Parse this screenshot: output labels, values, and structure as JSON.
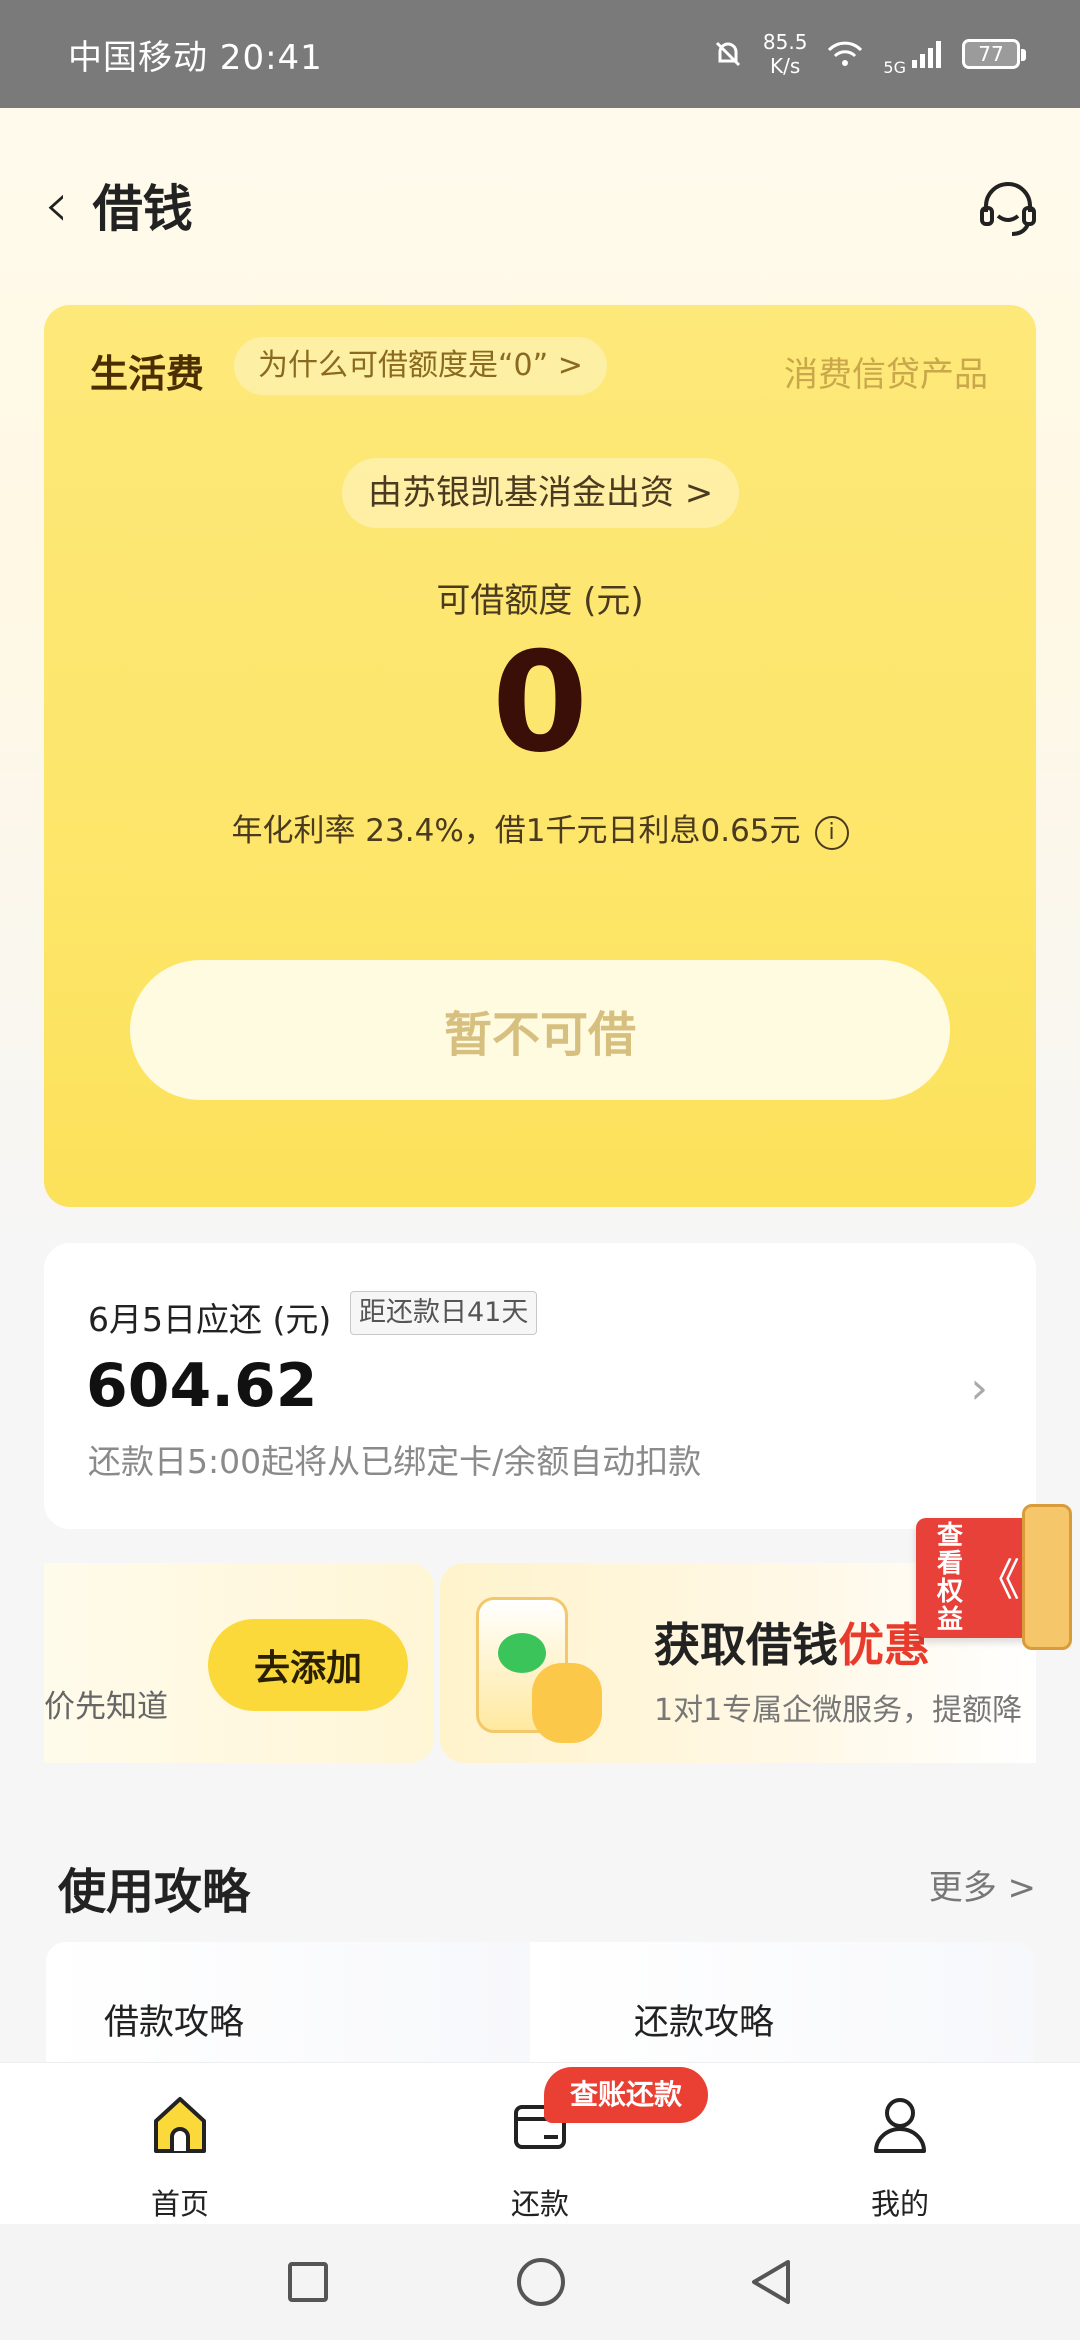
{
  "status_bar": {
    "carrier_time": "中国移动 20:41",
    "net_speed_value": "85.5",
    "net_speed_unit": "K/s",
    "network": "5G",
    "battery": "77"
  },
  "header": {
    "title": "借钱"
  },
  "loan_card": {
    "product_name": "生活费",
    "why_zero": "为什么可借额度是“0” >",
    "category": "消费信贷产品",
    "funder": "由苏银凯基消金出资 >",
    "limit_label": "可借额度 (元)",
    "limit_value": "0",
    "rate_text": "年化利率 23.4%，借1千元日利息0.65元",
    "info_icon": "i",
    "button_label": "暂不可借"
  },
  "repayment": {
    "due_label": "6月5日应还 (元)",
    "countdown": "距还款日41天",
    "amount": "604.62",
    "note": "还款日5:00起将从已绑定卡/余额自动扣款"
  },
  "promo_left": {
    "text": "价先知道",
    "button_label": "去添加"
  },
  "promo_right": {
    "title_main": "获取借钱",
    "title_highlight": "优惠",
    "subtitle": "1对1专属企微服务，提额降"
  },
  "ribbon": {
    "text": "查看权益",
    "arrow": "《"
  },
  "guide": {
    "title": "使用攻略",
    "more_label": "更多 >",
    "items": [
      {
        "label": "借款攻略"
      },
      {
        "label": "还款攻略"
      }
    ]
  },
  "tabbar": {
    "tabs": [
      {
        "label": "首页"
      },
      {
        "label": "还款"
      },
      {
        "label": "我的"
      }
    ],
    "badge": "查账还款"
  },
  "colors": {
    "card_yellow": "#fde66a",
    "highlight_red": "#e83b2c",
    "home_icon": "#fbd93a"
  }
}
